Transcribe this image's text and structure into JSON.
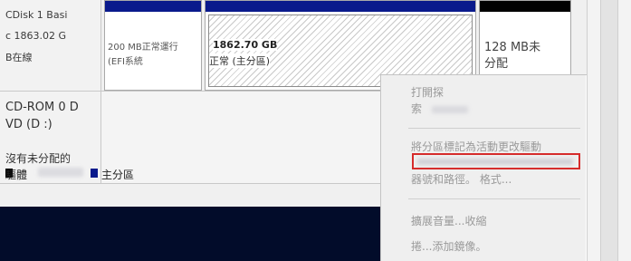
{
  "disk": {
    "name": "CDisk 1 Basi",
    "size": "c 1863.02 G",
    "status": "B在線"
  },
  "partitions": [
    {
      "size_line": "200 MB正常運行",
      "type_line": "(EFI系統",
      "bar": "blue"
    },
    {
      "size_line": "1862.70 GB",
      "type_line": "正常 (主分區)",
      "bar": "blue",
      "hatched": true
    },
    {
      "size_line": "128 MB未",
      "type_line": "分配",
      "bar": "black"
    }
  ],
  "cdrom": {
    "name": "CD-ROM 0 D",
    "drive": "VD (D :)",
    "status": "沒有未分配的"
  },
  "legend": {
    "unallocated": "驅體",
    "primary": "主分區"
  },
  "context_menu": {
    "items": [
      {
        "label": "打開探",
        "enabled": false
      },
      {
        "label": "索",
        "enabled": false
      },
      {
        "label": "將分區標記為活動更改驅動",
        "enabled": false
      },
      {
        "label": "器號和路徑。 格式...",
        "enabled": false
      },
      {
        "label": "擴展音量...收縮",
        "enabled": false
      },
      {
        "label": "捲...添加鏡像。",
        "enabled": false
      }
    ]
  },
  "colors": {
    "partition_bar": "#0a1a8c",
    "unallocated_bar": "#000000",
    "highlight": "#d62b2b"
  }
}
